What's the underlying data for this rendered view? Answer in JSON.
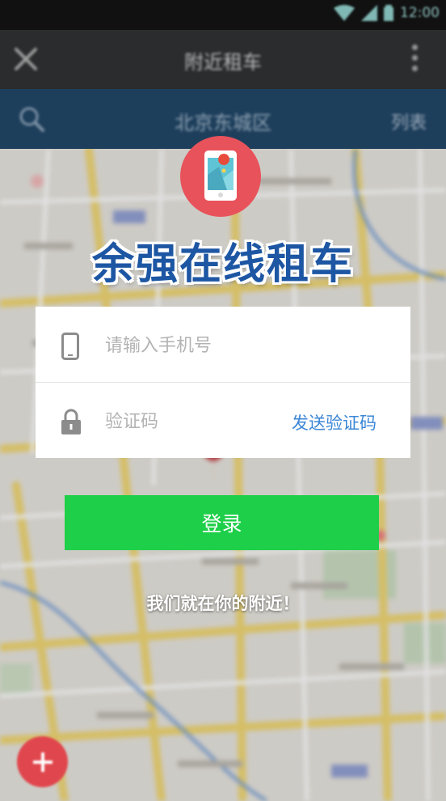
{
  "status_bar": {
    "time": "12:00"
  },
  "title_bar": {
    "title": "附近租车"
  },
  "search_bar": {
    "location": "北京东城区",
    "list_label": "列表"
  },
  "brand": {
    "name": "余强在线租车"
  },
  "form": {
    "phone_placeholder": "请输入手机号",
    "phone_value": "",
    "code_placeholder": "验证码",
    "code_value": "",
    "send_code_label": "发送验证码"
  },
  "login": {
    "label": "登录"
  },
  "tagline": "我们就在你的附近！",
  "icons": {
    "close": "close-icon",
    "more": "more-vertical-icon",
    "search": "search-icon",
    "phone": "phone-icon",
    "lock": "lock-icon",
    "logo": "map-pin-phone-icon",
    "fab": "plus-icon"
  },
  "colors": {
    "title_bar": "#2a2c2d",
    "search_bar": "#1e3f5c",
    "logo_circle": "#e8535b",
    "brand_text": "#1d56a3",
    "send_code": "#3b86d6",
    "login_button": "#1ecf49",
    "fab": "#e0464d"
  }
}
